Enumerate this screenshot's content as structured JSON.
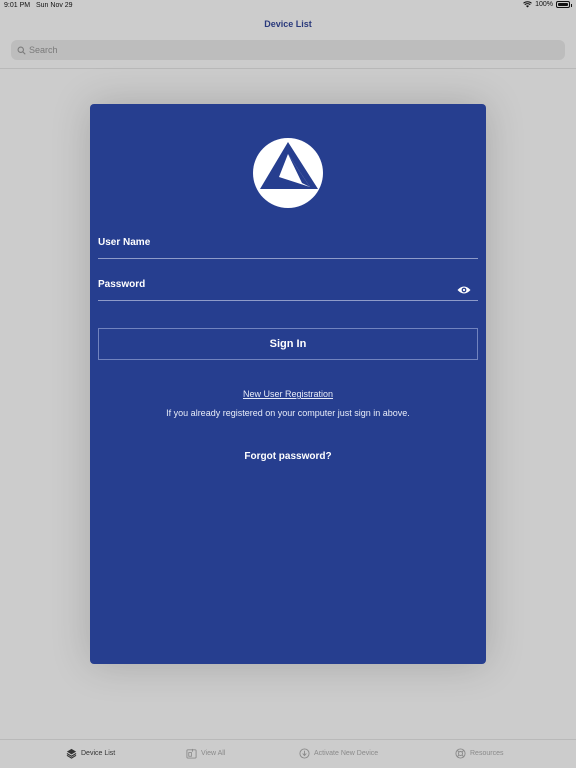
{
  "status_bar": {
    "time": "9:01 PM",
    "date": "Sun Nov 29",
    "battery": "100%"
  },
  "nav": {
    "title": "Device List"
  },
  "search": {
    "placeholder": "Search"
  },
  "login": {
    "username_label": "User Name",
    "password_label": "Password",
    "signin_label": "Sign In",
    "register_link": "New User Registration",
    "register_hint": "If you already registered on your computer just sign in above.",
    "forgot_link": "Forgot password?"
  },
  "tabs": [
    {
      "label": "Device List",
      "icon": "layers-icon",
      "active": true
    },
    {
      "label": "View All",
      "icon": "view-all-icon",
      "active": false
    },
    {
      "label": "Activate New Device",
      "icon": "activate-icon",
      "active": false
    },
    {
      "label": "Resources",
      "icon": "lifebuoy-icon",
      "active": false
    }
  ],
  "colors": {
    "card": "#263e8f",
    "nav_title": "#2a3a7c",
    "background": "#cccccc"
  }
}
